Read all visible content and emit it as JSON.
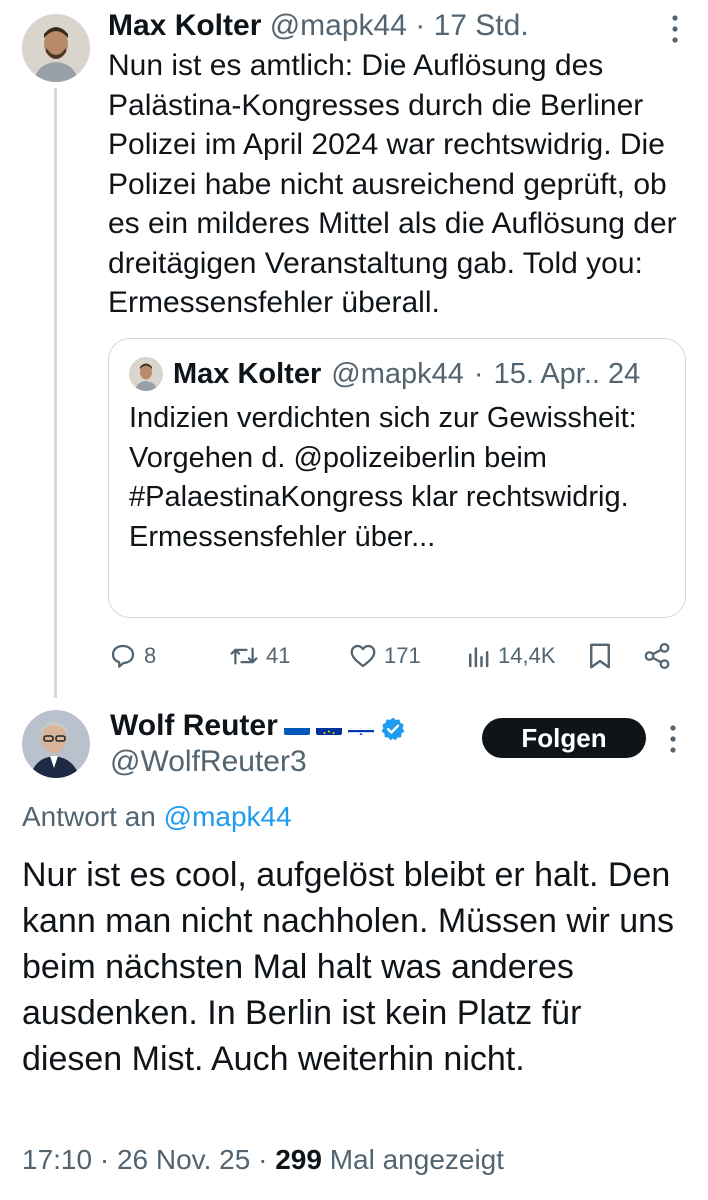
{
  "tweet": {
    "author_name": "Max Kolter",
    "author_handle": "@mapk44",
    "separator": "·",
    "time": "17 Std.",
    "text": "Nun ist es amtlich: Die Auflösung des Palästina-Kongresses durch die Berliner Polizei im April 2024 war rechtswidrig. Die Polizei habe nicht ausreichend geprüft, ob es ein milderes Mittel als die Auflösung der dreitägigen Veranstaltung gab. Told you: Ermessensfehler überall.",
    "quote": {
      "author_name": "Max Kolter",
      "author_handle": "@mapk44",
      "separator": "·",
      "time": "15. Apr.. 24",
      "text": "Indizien verdichten sich zur Gewissheit: Vorgehen d. @polizeiberlin beim #PalaestinaKongress klar rechtswidrig. Ermessensfehler über..."
    },
    "actions": {
      "replies": "8",
      "reposts": "41",
      "likes": "171",
      "views": "14,4K"
    }
  },
  "reply": {
    "author_name": "Wolf Reuter",
    "author_handle": "@WolfReuter3",
    "flags": [
      "ukraine-flag",
      "eu-flag",
      "israel-flag"
    ],
    "follow_label": "Folgen",
    "reply_to_prefix": "Antwort an",
    "reply_to_handle": "@mapk44",
    "text": "Nur ist es cool, aufgelöst bleibt er halt. Den kann man nicht nachholen. Müssen wir uns beim nächsten Mal halt was anderes ausdenken. In Berlin ist kein Platz für diesen Mist. Auch weiterhin nicht.",
    "time": "17:10",
    "separator": "·",
    "date": "26 Nov. 25",
    "views_count": "299",
    "views_label": "Mal angezeigt"
  },
  "colors": {
    "text": "#0f1419",
    "muted": "#536471",
    "link": "#1d9bf0",
    "border": "#cfd9de",
    "verified": "#1d9bf0",
    "follow_bg": "#0f1419"
  }
}
